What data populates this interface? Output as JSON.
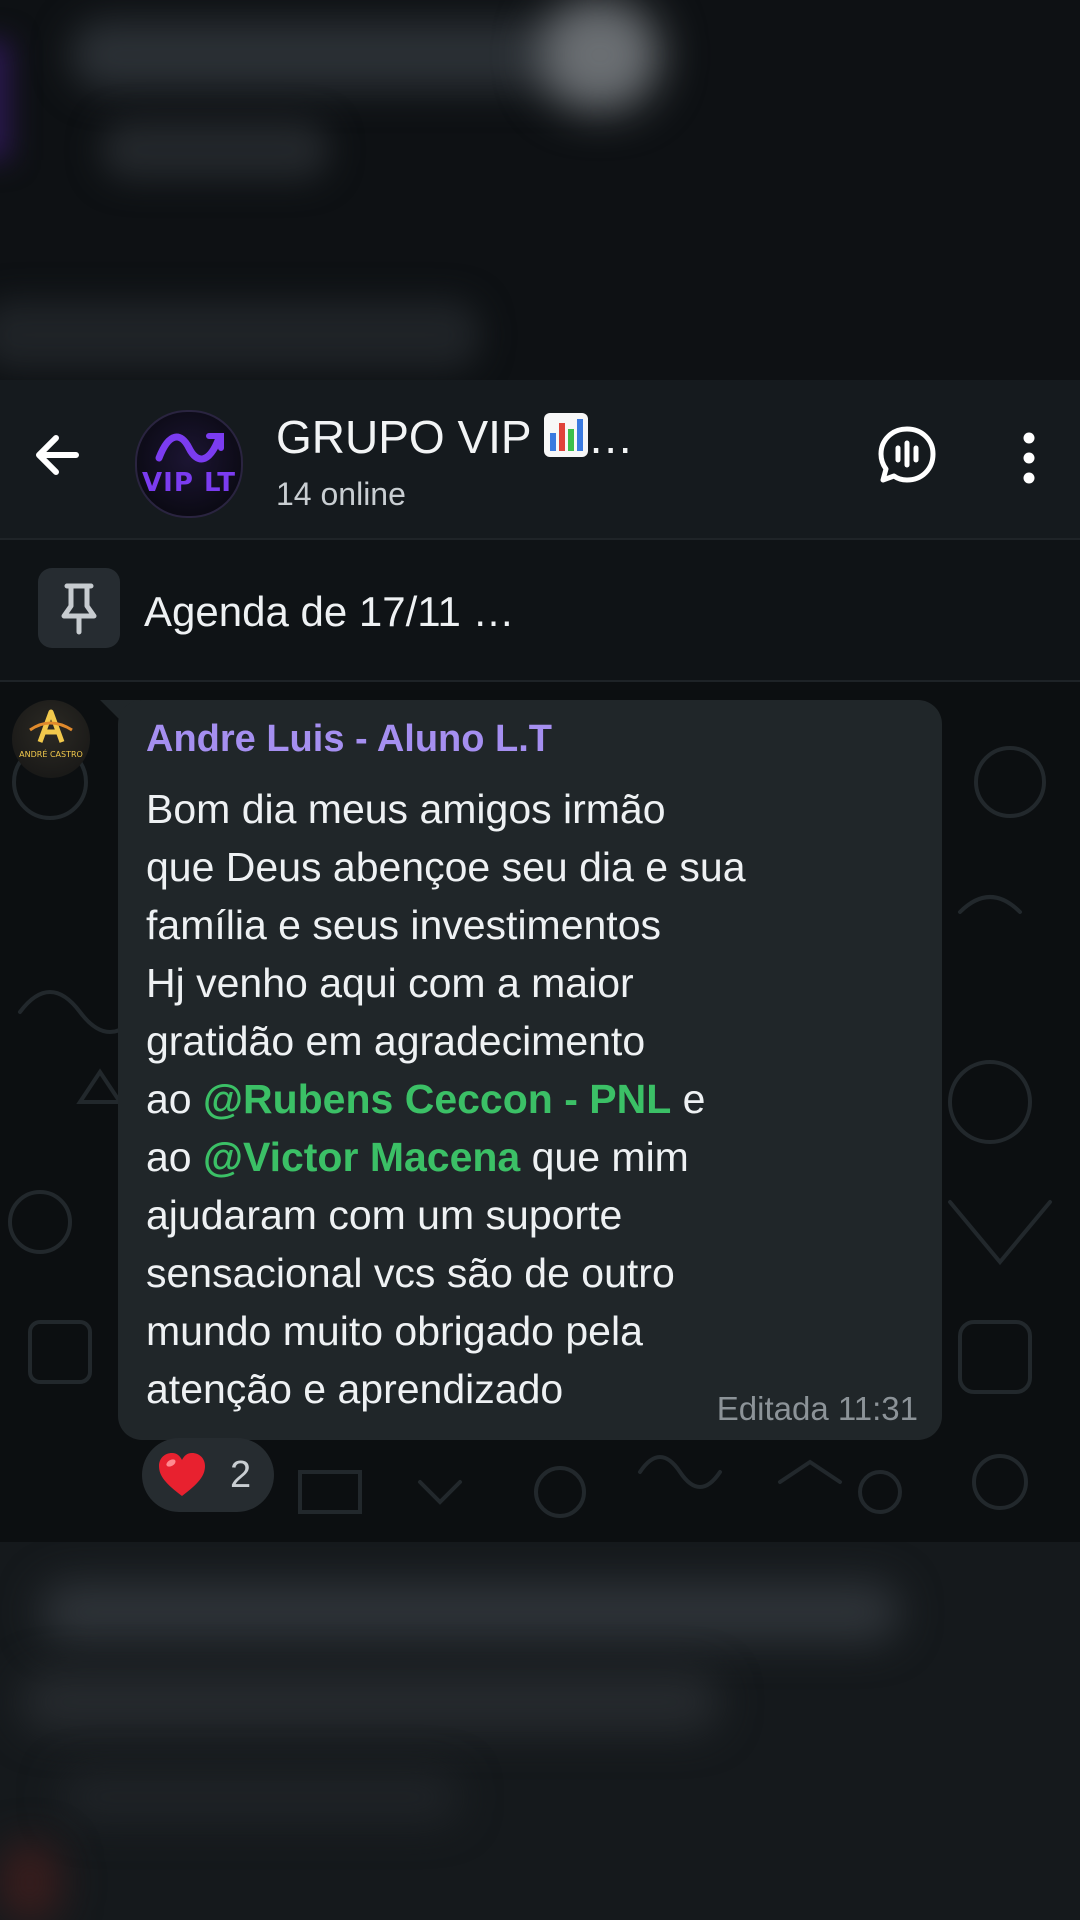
{
  "header": {
    "title": "GRUPO VIP",
    "title_suffix": "…",
    "subtitle": "14 online",
    "avatar_text": "VIP LT",
    "icons": [
      "back-arrow-icon",
      "voice-chat-icon",
      "more-vertical-icon"
    ]
  },
  "pinned": {
    "text": "Agenda de 17/11 …",
    "icon": "pin-icon"
  },
  "message": {
    "sender": "Andre Luis - Aluno L.T",
    "avatar_text": "ANDRÉ CASTRO",
    "lines": {
      "l1": "Bom dia meus amigos irmão",
      "l2": "que Deus abençoe seu dia e sua",
      "l3": "família e seus investimentos",
      "l4": "Hj venho aqui com a maior",
      "l5": "gratidão em agradecimento",
      "l6_pre": "ao ",
      "l6_mention": "@Rubens Ceccon - PNL",
      "l6_post": " e",
      "l7_pre": "ao ",
      "l7_mention": "@Victor Macena",
      "l7_post": " que mim",
      "l8": "ajudaram com um suporte",
      "l9": "sensacional vcs são de outro",
      "l10": "mundo muito obrigado pela",
      "l11": "atenção e aprendizado"
    },
    "meta": "Editada 11:31",
    "reaction": {
      "emoji": "heart-icon",
      "count": "2"
    }
  },
  "colors": {
    "header_bg": "#151a1e",
    "bubble_bg": "#202629",
    "sender_name": "#a58ff0",
    "mention": "#3bc066",
    "brand_purple": "#7b3cf0"
  }
}
